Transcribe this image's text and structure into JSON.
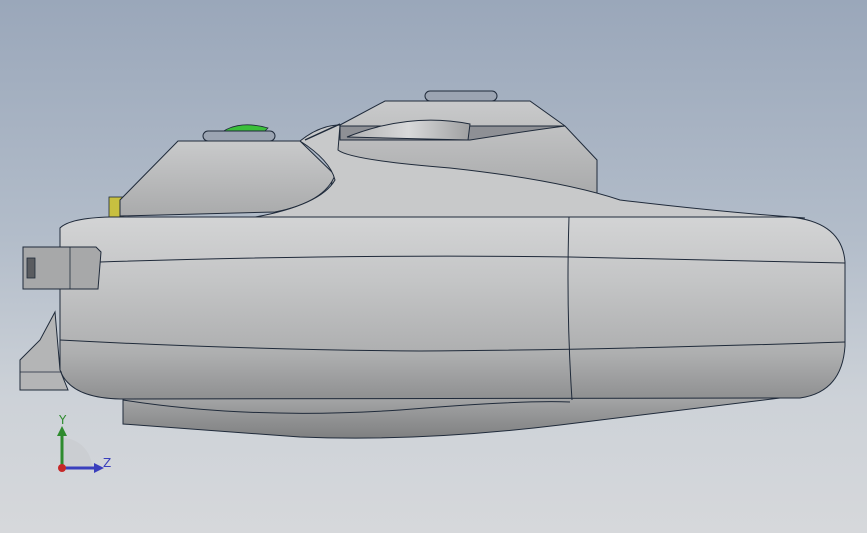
{
  "viewport": {
    "description_colors": {
      "background_top": "#9aa7ba",
      "background_bottom": "#d6d8db",
      "body_fill": "#bfc0c1",
      "edge_color": "#1f2a3a",
      "button_green": "#3bbf3b",
      "trigger_yellow": "#c8c040"
    }
  },
  "triad": {
    "y_label": "Y",
    "z_label": "Z",
    "y_color": "#2e8b2e",
    "z_color": "#3a3fbd",
    "x_color": "#c62828"
  }
}
